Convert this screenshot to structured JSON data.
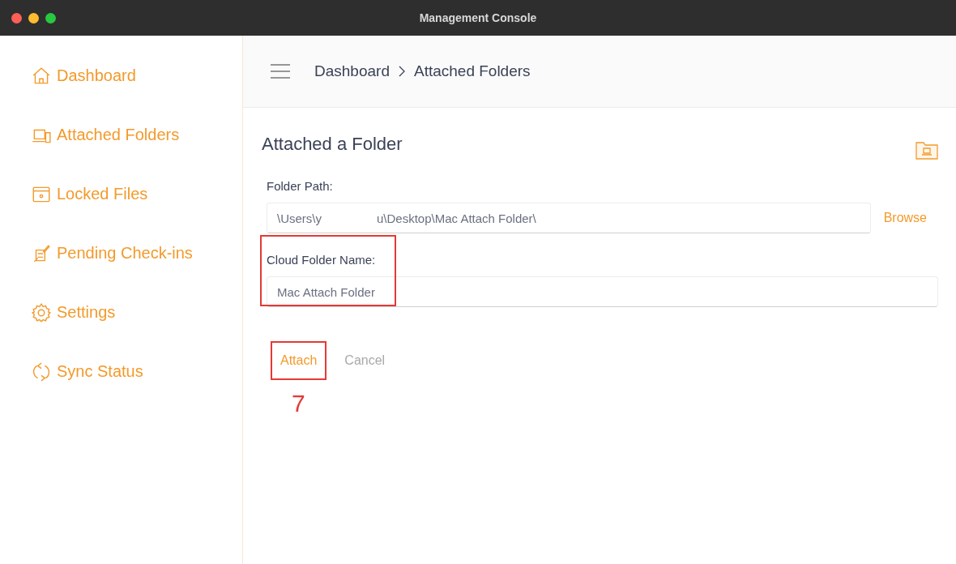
{
  "window": {
    "title": "Management Console"
  },
  "sidebar": {
    "items": [
      {
        "label": "Dashboard"
      },
      {
        "label": "Attached Folders"
      },
      {
        "label": "Locked Files"
      },
      {
        "label": "Pending Check-ins"
      },
      {
        "label": "Settings"
      },
      {
        "label": "Sync Status"
      }
    ]
  },
  "breadcrumb": [
    "Dashboard",
    "Attached Folders"
  ],
  "form": {
    "title": "Attached a Folder",
    "fields": [
      {
        "label": "Folder Path:",
        "value_parts": [
          "\\Users\\y",
          "u\\Desktop\\Mac Attach Folder\\"
        ],
        "action": "Browse",
        "highlighted": false
      },
      {
        "label": "Cloud Folder Name:",
        "value_parts": [
          "Mac Attach Folder"
        ],
        "highlighted": true
      }
    ],
    "buttons": [
      {
        "label": "Attach",
        "primary": true,
        "highlighted": true
      },
      {
        "label": "Cancel",
        "primary": false,
        "highlighted": false
      }
    ],
    "step_number": "7"
  }
}
